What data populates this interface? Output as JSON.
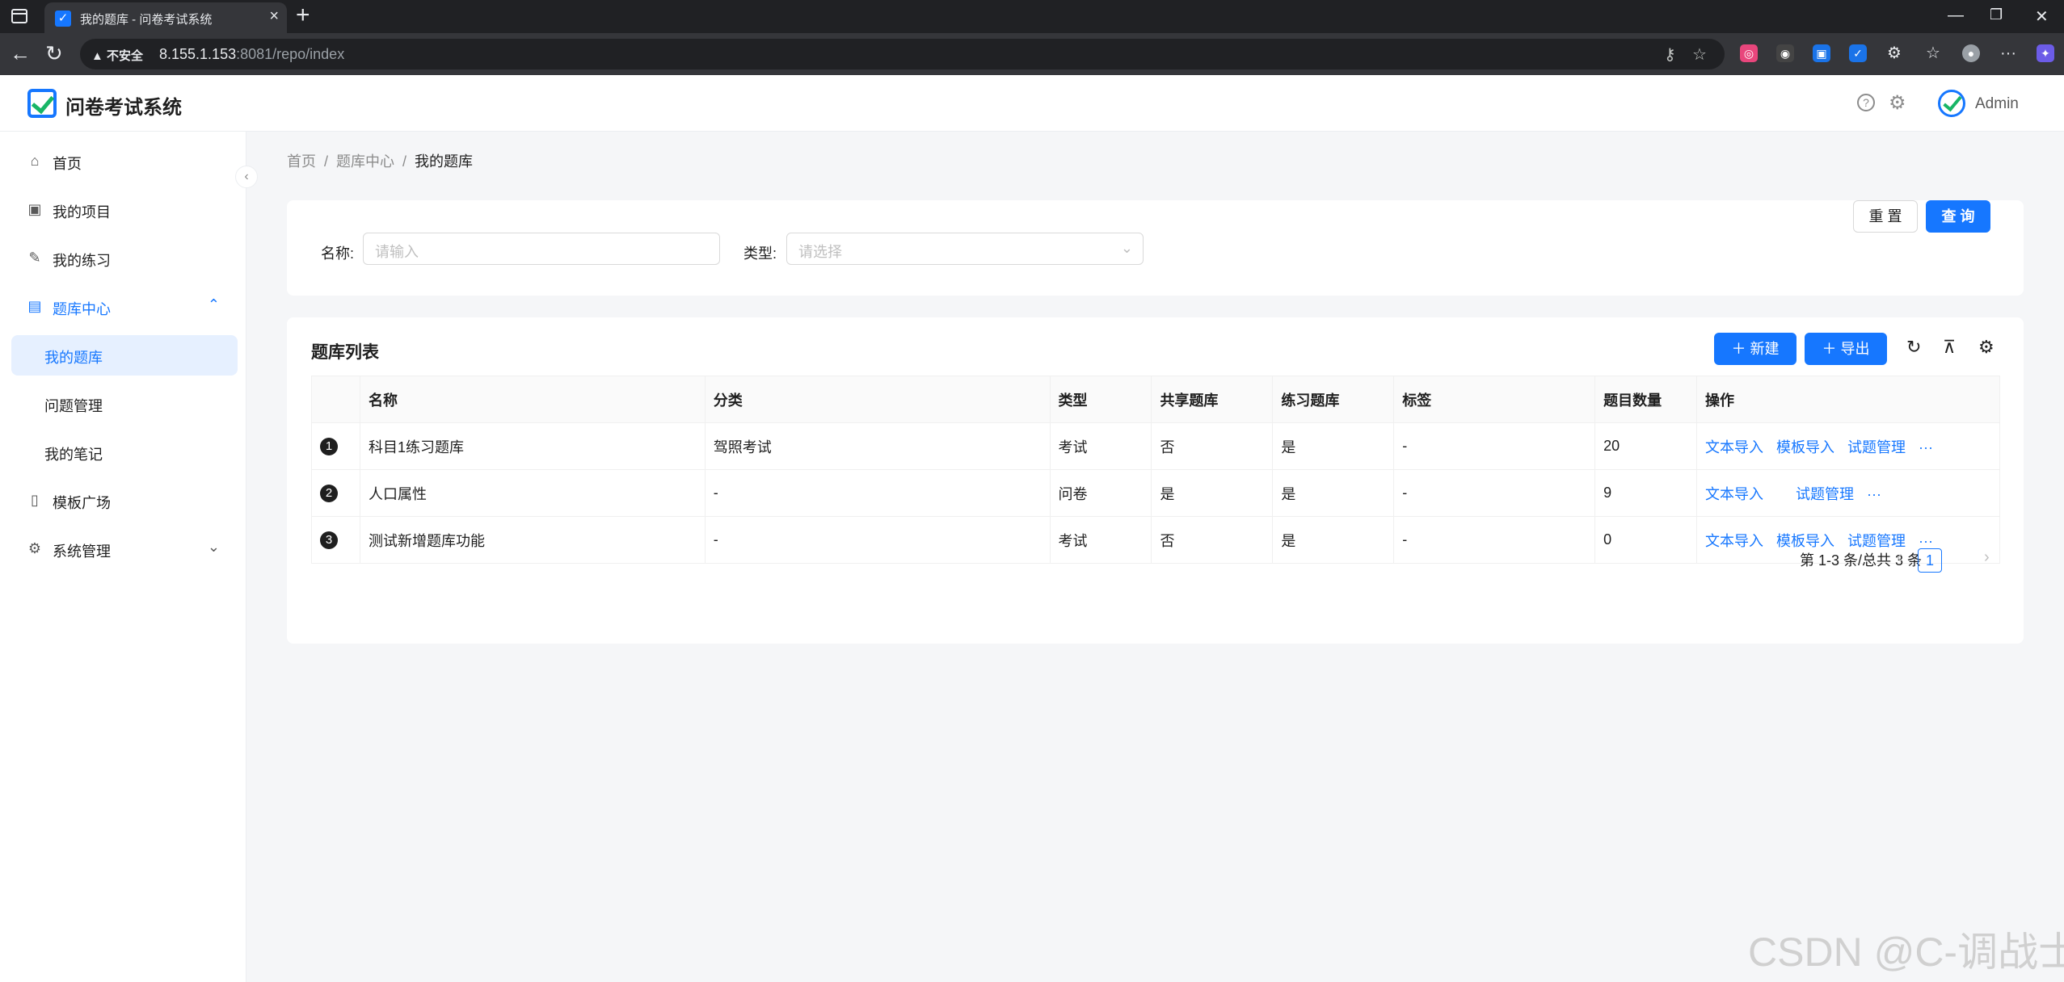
{
  "browser": {
    "tab_title": "我的题库 - 问卷考试系统",
    "security_label": "不安全",
    "url_host": "8.155.1.153",
    "url_rest": ":8081/repo/index"
  },
  "app": {
    "name": "问卷考试系统",
    "user_name": "Admin"
  },
  "sidebar": {
    "items": [
      {
        "label": "首页",
        "icon": "home-icon"
      },
      {
        "label": "我的项目",
        "icon": "project-icon"
      },
      {
        "label": "我的练习",
        "icon": "edit-icon"
      },
      {
        "label": "题库中心",
        "icon": "book-icon",
        "expanded": true
      },
      {
        "label": "我的题库",
        "selected": true
      },
      {
        "label": "问题管理"
      },
      {
        "label": "我的笔记"
      },
      {
        "label": "模板广场",
        "icon": "template-icon"
      },
      {
        "label": "系统管理",
        "icon": "settings-icon",
        "expanded": false
      }
    ]
  },
  "breadcrumb": [
    "首页",
    "题库中心",
    "我的题库"
  ],
  "search": {
    "name_label": "名称:",
    "name_placeholder": "请输入",
    "type_label": "类型:",
    "type_placeholder": "请选择",
    "reset_label": "重 置",
    "query_label": "查 询"
  },
  "table": {
    "title": "题库列表",
    "new_label": "新建",
    "export_label": "导出",
    "columns": [
      "",
      "名称",
      "分类",
      "类型",
      "共享题库",
      "练习题库",
      "标签",
      "题目数量",
      "操作"
    ],
    "rows": [
      {
        "index": "1",
        "name": "科目1练习题库",
        "category": "驾照考试",
        "type": "考试",
        "shared": "否",
        "practice": "是",
        "tag": "-",
        "count": "20",
        "actions": [
          "文本导入",
          "模板导入",
          "试题管理"
        ]
      },
      {
        "index": "2",
        "name": "人口属性",
        "category": "-",
        "type": "问卷",
        "shared": "是",
        "practice": "是",
        "tag": "-",
        "count": "9",
        "actions": [
          "文本导入",
          "试题管理"
        ]
      },
      {
        "index": "3",
        "name": "测试新增题库功能",
        "category": "-",
        "type": "考试",
        "shared": "否",
        "practice": "是",
        "tag": "-",
        "count": "0",
        "actions": [
          "文本导入",
          "模板导入",
          "试题管理"
        ]
      }
    ],
    "more_label": "···",
    "pagination_text": "第 1-3 条/总共 3 条",
    "current_page": "1"
  },
  "watermark": "CSDN @C-调战士",
  "colors": {
    "primary": "#1677ff",
    "check": "#18b566"
  }
}
